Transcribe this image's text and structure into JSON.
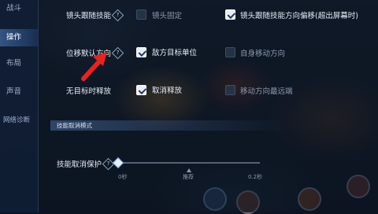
{
  "sidebar": {
    "items": [
      {
        "label": "战斗",
        "active": false
      },
      {
        "label": "操作",
        "active": true
      },
      {
        "label": "布局",
        "active": false
      },
      {
        "label": "声音",
        "active": false
      },
      {
        "label": "网络诊断",
        "active": false
      }
    ]
  },
  "options": {
    "lens_follow_skill": {
      "label": "镜头跟随技能",
      "help": "?"
    },
    "lens_fixed": {
      "label": "镜头固定",
      "checked": false
    },
    "lens_follow_offset": {
      "label": "镜头跟随技能方向偏移(超出屏幕时)",
      "checked": true
    },
    "default_direction": {
      "label": "位移默认方向",
      "help": "?"
    },
    "enemy_target": {
      "label": "敌方目标单位",
      "checked": true
    },
    "self_move_dir": {
      "label": "自身移动方向",
      "checked": false
    },
    "no_target_cast": {
      "label": "无目标时释放"
    },
    "cancel_cast": {
      "label": "取消释放",
      "checked": true
    },
    "move_dir_farthest": {
      "label": "移动方向最远端",
      "checked": false
    }
  },
  "section": {
    "title": "技能取消模式"
  },
  "cancel_protect": {
    "label": "技能取消保护",
    "help": "?",
    "value_fraction": 0.0,
    "min_label": "0秒",
    "mid_label": "推荐",
    "max_label": "0.2秒"
  },
  "colors": {
    "accent": "#3a7bd5",
    "arrow": "#e8231e"
  }
}
